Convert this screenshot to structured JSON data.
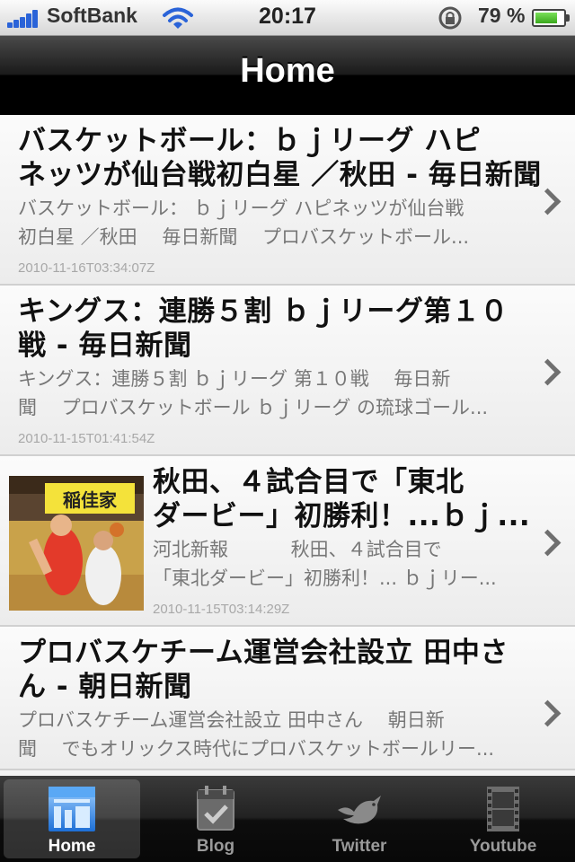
{
  "status_bar": {
    "carrier": "SoftBank",
    "time": "20:17",
    "battery_percent": "79 %",
    "battery_level": 0.79
  },
  "nav": {
    "title": "Home"
  },
  "articles": [
    {
      "title_line1": "バスケットボール：ｂｊリーグ ハピ",
      "title_line2": "ネッツが仙台戦初白星 ／秋田 - 毎日新聞",
      "summary_line1": "バスケットボール： ｂｊリーグ  ハピネッツが仙台戦",
      "summary_line2": "初白星 ／秋田　   毎日新聞　 プロバスケットボール...",
      "date": "2010-11-16T03:34:07Z"
    },
    {
      "title_line1": "キングス：連勝５割 ｂｊリーグ第１０",
      "title_line2": "戦 - 毎日新聞",
      "summary_line1": "キングス：連勝５割   ｂｊリーグ 第１０戦　   毎日新",
      "summary_line2": "聞　  プロバスケットボール ｂｊリーグ の琉球ゴール...",
      "date": "2010-11-15T01:41:54Z"
    },
    {
      "title_line1": "秋田、４試合目で「東北",
      "title_line2": "ダービー」初勝利！...ｂｊ...",
      "summary_line1": "河北新報　　　 秋田、４試合目で",
      "summary_line2": "「東北ダービー」初勝利！... ｂｊリー...",
      "date": "2010-11-15T03:14:29Z",
      "thumb_banner": "稲佳家"
    },
    {
      "title_line1": "プロバスケチーム運営会社設立 田中さ",
      "title_line2": "ん - 朝日新聞",
      "summary_line1": "プロバスケチーム運営会社設立 田中さん　   朝日新",
      "summary_line2": "聞　 でもオリックス時代にプロバスケットボールリー..."
    }
  ],
  "tabs": [
    {
      "label": "Home",
      "icon": "home-icon",
      "active": true
    },
    {
      "label": "Blog",
      "icon": "calendar-check-icon",
      "active": false
    },
    {
      "label": "Twitter",
      "icon": "bird-icon",
      "active": false
    },
    {
      "label": "Youtube",
      "icon": "film-icon",
      "active": false
    }
  ],
  "colors": {
    "navbar": "#000000",
    "tab_active_label": "#ffffff",
    "tab_inactive_label": "#9a9a9a",
    "signal": "#2a63d8",
    "battery": "#3aa81c"
  }
}
